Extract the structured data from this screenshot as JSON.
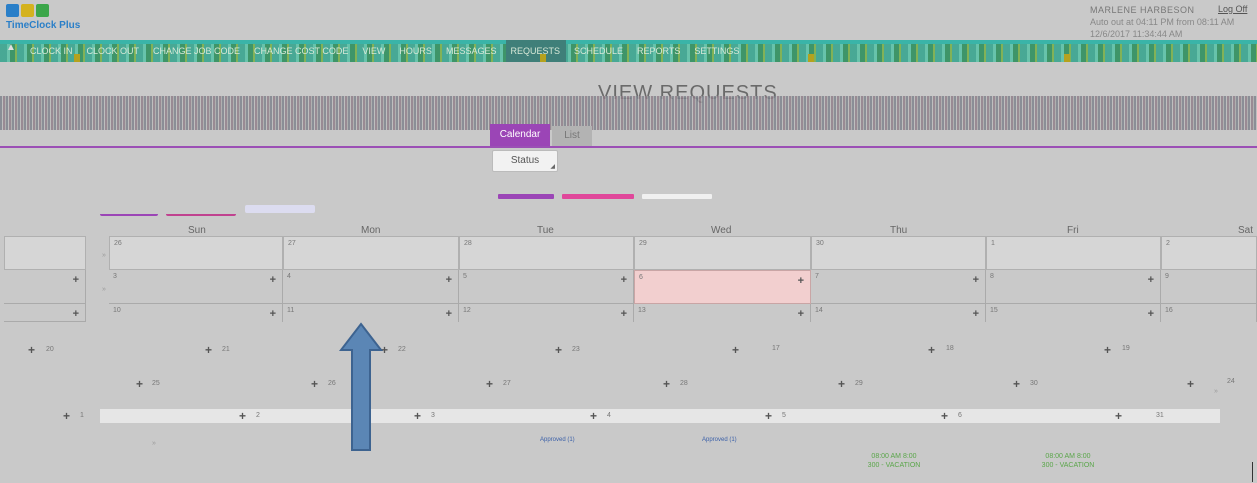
{
  "app": {
    "name": "TimeClock Plus",
    "user_name": "MARLENE HARBESON",
    "auto_out": "Auto out at 04:11 PM from 08:11 AM",
    "datetime": "12/6/2017 11:34:44 AM",
    "logoff": "Log Off"
  },
  "nav": {
    "items": [
      "CLOCK IN",
      "CLOCK OUT",
      "CHANGE JOB CODE",
      "CHANGE COST CODE",
      "VIEW",
      "HOURS",
      "MESSAGES",
      "REQUESTS",
      "SCHEDULE",
      "REPORTS",
      "SETTINGS"
    ]
  },
  "page": {
    "title": "VIEW REQUESTS"
  },
  "tabs": {
    "calendar": "Calendar",
    "list": "List"
  },
  "filter": {
    "status": "Status"
  },
  "calendar": {
    "days": [
      "Sun",
      "Mon",
      "Tue",
      "Wed",
      "Thu",
      "Fri",
      "Sat"
    ],
    "week1": [
      "26",
      "27",
      "28",
      "29",
      "30",
      "1",
      "2"
    ],
    "week2": [
      "3",
      "4",
      "5",
      "6",
      "7",
      "8",
      "9"
    ],
    "week3": [
      "10",
      "11",
      "12",
      "13",
      "14",
      "15",
      "16"
    ],
    "row4": [
      "20",
      "21",
      "22",
      "23",
      "17",
      "18",
      "19"
    ],
    "row5": [
      "25",
      "26",
      "27",
      "28",
      "29",
      "30",
      "24"
    ],
    "row6": [
      "1",
      "2",
      "3",
      "4",
      "5",
      "6",
      "31"
    ],
    "approved": [
      "Approved (1)",
      "Approved (1)"
    ],
    "events": [
      {
        "time": "08:00 AM 8:00",
        "code": "300 - VACATION"
      },
      {
        "time": "08:00 AM 8:00",
        "code": "300 - VACATION"
      }
    ],
    "today_index": 3
  },
  "colors": {
    "accent": "#9b45b6",
    "pink": "#e0479a",
    "today": "#f2cfcf",
    "nav": "#3aa58f",
    "event": "#5aa64a"
  }
}
